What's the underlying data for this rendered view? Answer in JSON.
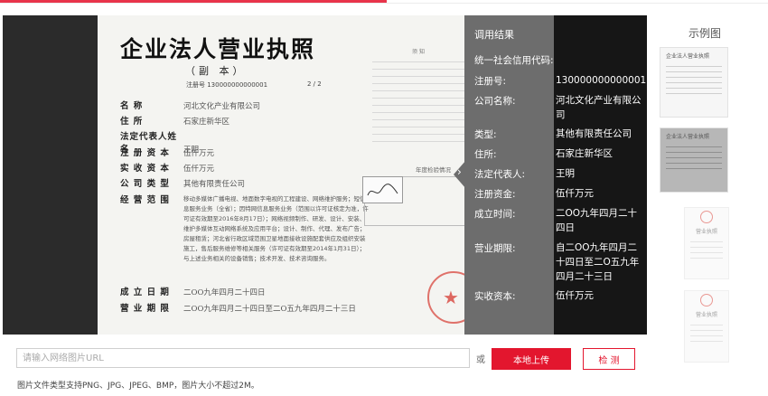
{
  "colors": {
    "accent": "#e3162e",
    "result_panel": "#161616",
    "result_label_panel": "#6d6d6d",
    "stage_bg": "#2b2b2b"
  },
  "license": {
    "title": "企业法人营业执照",
    "subtitle": "（副 本）",
    "reg_line": "注册号    130000000000001",
    "reg_page": "2 / 2",
    "rows": [
      {
        "label": "名      称",
        "value": "河北文化产业有限公司"
      },
      {
        "label": "住      所",
        "value": "石家庄新华区"
      },
      {
        "label": "法定代表人姓名",
        "value": "王明"
      },
      {
        "label": "注 册 资 本",
        "value": "伍仟万元"
      },
      {
        "label": "实 收 资 本",
        "value": "伍仟万元"
      },
      {
        "label": "公 司 类 型",
        "value": "其他有限责任公司"
      },
      {
        "label": "经 营 范 围",
        "value": ""
      }
    ],
    "scope_text": "移动多媒体广播电视、地面数字电视的工程建设、网络维护服务；短信息服务业务（全省）；因特网信息服务业务（范围以许可证核定为准，许可证有效期至2016年8月17日）；网络视频制作、研发、设计、安装、维护多媒体互动网络系统及应用平台；设计、制作、代理、发布广告；房屋租赁；河北省行政区域范围卫星地面接收设施配套供应及组织安装施工，售后服务维修等相关服务（许可证有效期至2014年1月31日）；与上述业务相关的设备销售；技术开发、技术咨询服务。",
    "established_label": "成 立 日 期",
    "established_value": "二OO九年四月二十四日",
    "term_label": "营 业 期 限",
    "term_value": "二OO九年四月二十四日至二O五九年四月二十三日",
    "notice_title": "须  知",
    "annual_label": "年度检验情况",
    "seal_text": "石家庄工商行政管理局"
  },
  "result": {
    "header": "调用结果",
    "fields": [
      {
        "key": "统一社会信用代码:",
        "value": ""
      },
      {
        "key": "注册号:",
        "value": "130000000000001"
      },
      {
        "key": "公司名称:",
        "value": "河北文化产业有限公司"
      },
      {
        "key": "类型:",
        "value": "其他有限责任公司"
      },
      {
        "key": "住所:",
        "value": "石家庄新华区"
      },
      {
        "key": "法定代表人:",
        "value": "王明"
      },
      {
        "key": "注册资金:",
        "value": "伍仟万元"
      },
      {
        "key": "成立时间:",
        "value": "二OO九年四月二十四日"
      },
      {
        "key": "营业期限:",
        "value": "自二OO九年四月二十四日至二O五九年四月二十三日"
      },
      {
        "key": "实收资本:",
        "value": "伍仟万元"
      }
    ]
  },
  "examples": {
    "title": "示例图",
    "thumb_titles": [
      "企业法人营业执照",
      "企业法人营业执照",
      "营业执照",
      "营业执照"
    ]
  },
  "upload": {
    "url_placeholder": "请输入网络图片URL",
    "url_value": "",
    "or_text": "或",
    "upload_button": "本地上传",
    "detect_button": "检 测",
    "hint": "图片文件类型支持PNG、JPG、JPEG、BMP，图片大小不超过2M。"
  }
}
